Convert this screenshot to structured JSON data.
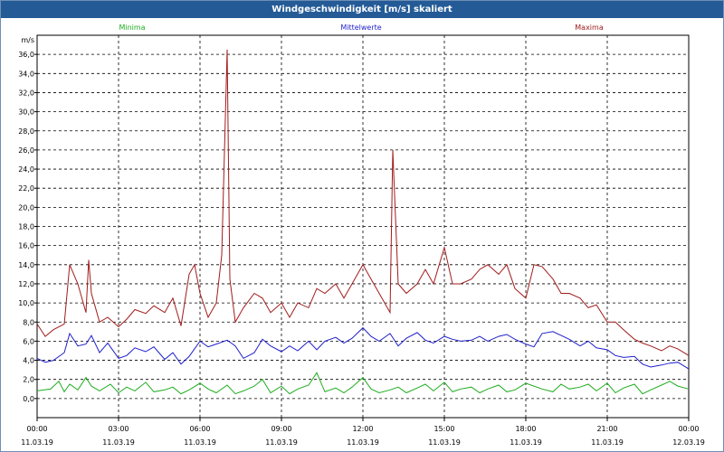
{
  "window": {
    "title": "Windgeschwindigkeit [m/s] skaliert"
  },
  "colors": {
    "minima": "#1fad1f",
    "mittel": "#1f1fcc",
    "maxima": "#a11b1b",
    "titlebar": "#245b97"
  },
  "chart_data": {
    "type": "line",
    "title": "Windgeschwindigkeit [m/s] skaliert",
    "ylabel": "m/s",
    "xlabel": "",
    "ylim": [
      -2,
      38
    ],
    "xlim_hours": [
      0,
      24
    ],
    "grid": true,
    "legend_placement": "top",
    "y_ticks": [
      "0,0",
      "2,0",
      "4,0",
      "6,0",
      "8,0",
      "10,0",
      "12,0",
      "14,0",
      "16,0",
      "18,0",
      "20,0",
      "22,0",
      "24,0",
      "26,0",
      "28,0",
      "30,0",
      "32,0",
      "34,0",
      "36,0"
    ],
    "x_ticks": [
      {
        "time": "00:00",
        "date": "11.03.19"
      },
      {
        "time": "03:00",
        "date": "11.03.19"
      },
      {
        "time": "06:00",
        "date": "11.03.19"
      },
      {
        "time": "09:00",
        "date": "11.03.19"
      },
      {
        "time": "12:00",
        "date": "11.03.19"
      },
      {
        "time": "15:00",
        "date": "11.03.19"
      },
      {
        "time": "18:00",
        "date": "11.03.19"
      },
      {
        "time": "21:00",
        "date": "11.03.19"
      },
      {
        "time": "00:00",
        "date": "12.03.19"
      }
    ],
    "series": [
      {
        "name": "Minima",
        "color": "#1fad1f",
        "x": [
          0,
          0.5,
          0.8,
          1,
          1.2,
          1.5,
          1.8,
          2,
          2.3,
          2.7,
          3,
          3.3,
          3.6,
          4,
          4.3,
          4.7,
          5,
          5.3,
          5.6,
          6,
          6.3,
          6.6,
          7,
          7.3,
          7.6,
          8,
          8.3,
          8.6,
          9,
          9.3,
          9.6,
          10,
          10.3,
          10.6,
          11,
          11.3,
          11.6,
          12,
          12.3,
          12.6,
          13,
          13.3,
          13.6,
          14,
          14.3,
          14.6,
          15,
          15.3,
          15.6,
          16,
          16.3,
          16.6,
          17,
          17.3,
          17.6,
          18,
          18.3,
          18.6,
          19,
          19.3,
          19.6,
          20,
          20.3,
          20.6,
          21,
          21.3,
          21.6,
          22,
          22.3,
          22.6,
          23,
          23.3,
          23.6,
          24
        ],
        "y": [
          0.8,
          1.0,
          1.8,
          0.7,
          1.5,
          0.9,
          2.2,
          1.3,
          0.8,
          1.5,
          0.6,
          1.2,
          0.8,
          1.7,
          0.7,
          0.9,
          1.2,
          0.5,
          0.9,
          1.6,
          1.0,
          0.6,
          1.4,
          0.5,
          0.8,
          1.3,
          2.0,
          0.6,
          1.3,
          0.5,
          1.0,
          1.4,
          2.7,
          0.7,
          1.1,
          0.6,
          1.2,
          2.2,
          1.0,
          0.6,
          0.9,
          1.2,
          0.6,
          1.1,
          1.5,
          0.8,
          1.7,
          0.7,
          1.0,
          1.2,
          0.6,
          1.0,
          1.4,
          0.7,
          0.9,
          1.6,
          1.3,
          1.0,
          0.7,
          1.5,
          1.0,
          1.2,
          1.5,
          0.8,
          1.6,
          0.6,
          1.1,
          1.5,
          0.5,
          0.9,
          1.4,
          1.8,
          1.3,
          1.0
        ]
      },
      {
        "name": "Mittelwerte",
        "color": "#1f1fcc",
        "x": [
          0,
          0.3,
          0.6,
          1,
          1.2,
          1.5,
          1.8,
          2,
          2.3,
          2.6,
          3,
          3.3,
          3.6,
          4,
          4.3,
          4.7,
          5,
          5.3,
          5.6,
          6,
          6.3,
          6.6,
          7,
          7.3,
          7.6,
          8,
          8.3,
          8.6,
          9,
          9.3,
          9.6,
          10,
          10.3,
          10.6,
          11,
          11.3,
          11.6,
          12,
          12.3,
          12.6,
          13,
          13.3,
          13.6,
          14,
          14.3,
          14.6,
          15,
          15.3,
          15.6,
          16,
          16.3,
          16.6,
          17,
          17.3,
          17.6,
          18,
          18.3,
          18.6,
          19,
          19.3,
          19.6,
          20,
          20.3,
          20.6,
          21,
          21.3,
          21.6,
          22,
          22.3,
          22.6,
          23,
          23.3,
          23.6,
          24
        ],
        "y": [
          4.2,
          3.8,
          4.0,
          4.8,
          6.8,
          5.5,
          5.7,
          6.6,
          4.8,
          5.8,
          4.2,
          4.5,
          5.3,
          4.9,
          5.4,
          4.1,
          4.8,
          3.6,
          4.4,
          6.0,
          5.4,
          5.7,
          6.1,
          5.5,
          4.2,
          4.8,
          6.2,
          5.5,
          4.9,
          5.5,
          5.0,
          6.0,
          5.1,
          6.0,
          6.4,
          5.8,
          6.3,
          7.4,
          6.5,
          6.0,
          6.8,
          5.5,
          6.3,
          6.9,
          6.1,
          5.8,
          6.5,
          6.2,
          6.0,
          6.1,
          6.5,
          6.0,
          6.5,
          6.7,
          6.2,
          5.7,
          5.4,
          6.8,
          7.0,
          6.6,
          6.2,
          5.5,
          6.0,
          5.3,
          5.1,
          4.5,
          4.3,
          4.4,
          3.6,
          3.3,
          3.5,
          3.7,
          3.8,
          3.1
        ]
      },
      {
        "name": "Maxima",
        "color": "#a11b1b",
        "x": [
          0,
          0.3,
          0.6,
          1,
          1.2,
          1.5,
          1.8,
          1.9,
          2,
          2.3,
          2.6,
          3,
          3.3,
          3.6,
          4,
          4.3,
          4.7,
          5,
          5.3,
          5.6,
          5.8,
          6,
          6.3,
          6.6,
          6.8,
          7,
          7.1,
          7.3,
          7.6,
          8,
          8.3,
          8.6,
          9,
          9.3,
          9.6,
          10,
          10.3,
          10.6,
          11,
          11.3,
          11.6,
          12,
          12.3,
          12.6,
          13,
          13.1,
          13.3,
          13.6,
          14,
          14.3,
          14.6,
          15,
          15.3,
          15.6,
          16,
          16.3,
          16.6,
          17,
          17.3,
          17.6,
          18,
          18.3,
          18.6,
          19,
          19.3,
          19.6,
          20,
          20.3,
          20.6,
          21,
          21.3,
          21.6,
          22,
          22.3,
          22.6,
          23,
          23.3,
          23.6,
          24
        ],
        "y": [
          7.8,
          6.5,
          7.2,
          7.8,
          14.0,
          12.0,
          9.0,
          14.5,
          11.0,
          8.0,
          8.5,
          7.5,
          8.3,
          9.3,
          8.9,
          9.7,
          9.0,
          10.5,
          7.6,
          13.0,
          14.0,
          11.0,
          8.5,
          10.0,
          15.0,
          36.5,
          12.5,
          8.0,
          9.5,
          11.0,
          10.5,
          9.0,
          10.0,
          8.5,
          10.0,
          9.5,
          11.5,
          11.0,
          12.0,
          10.5,
          12.0,
          14.0,
          12.5,
          11.0,
          9.0,
          26.0,
          12.0,
          11.0,
          12.0,
          13.5,
          12.0,
          15.8,
          12.0,
          12.0,
          12.5,
          13.5,
          14.0,
          13.0,
          14.0,
          11.5,
          10.5,
          14.0,
          13.8,
          12.5,
          11.0,
          11.0,
          10.5,
          9.5,
          9.8,
          8.0,
          8.0,
          7.2,
          6.2,
          5.8,
          5.5,
          5.0,
          5.5,
          5.2,
          4.5
        ]
      }
    ]
  }
}
